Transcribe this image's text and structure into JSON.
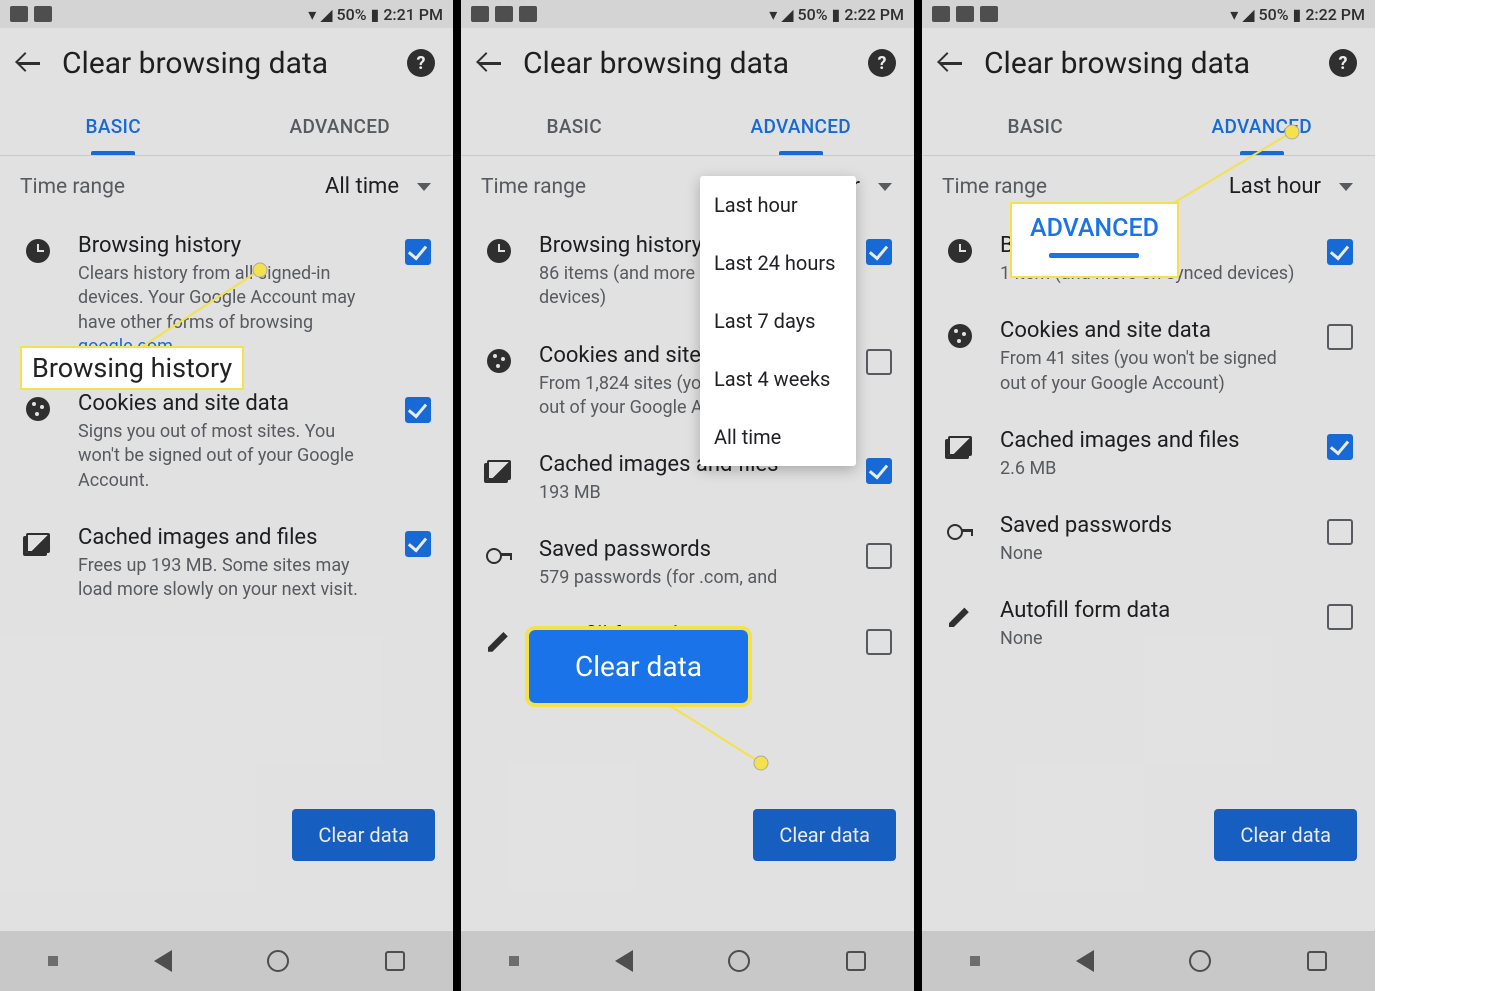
{
  "status": {
    "battery": "50%",
    "wifi_icon": "wifi-icon",
    "signal_icon": "signal-icon",
    "battery_icon": "battery-icon"
  },
  "screen1": {
    "time": "2:21 PM",
    "title": "Clear browsing data",
    "tabs": {
      "basic": "BASIC",
      "advanced": "ADVANCED",
      "active": "basic"
    },
    "time_range": {
      "label": "Time range",
      "value": "All time"
    },
    "items": [
      {
        "icon": "clock",
        "title": "Browsing history",
        "sub": "Clears history from all signed-in devices. Your Google Account may have other forms of browsing",
        "link": "google.com.",
        "checked": true
      },
      {
        "icon": "cookie",
        "title": "Cookies and site data",
        "sub": "Signs you out of most sites. You won't be signed out of your Google Account.",
        "checked": true
      },
      {
        "icon": "image",
        "title": "Cached images and files",
        "sub": "Frees up 193 MB. Some sites may load more slowly on your next visit.",
        "checked": true
      }
    ],
    "clear_btn": "Clear data",
    "callout": "Browsing history"
  },
  "screen2": {
    "time": "2:22 PM",
    "title": "Clear browsing data",
    "tabs": {
      "basic": "BASIC",
      "advanced": "ADVANCED",
      "active": "advanced"
    },
    "time_range": {
      "label": "Time range",
      "value": "Last hour"
    },
    "menu": [
      "Last hour",
      "Last 24 hours",
      "Last 7 days",
      "Last 4 weeks",
      "All time"
    ],
    "items": [
      {
        "icon": "clock",
        "title": "Browsing history",
        "sub": "86 items (and more on synced devices)",
        "checked": true
      },
      {
        "icon": "cookie",
        "title": "Cookies and site data",
        "sub": "From 1,824 sites (you won't be signed out of your Google Account)",
        "checked": false
      },
      {
        "icon": "image",
        "title": "Cached images and files",
        "sub": "193 MB",
        "checked": true
      },
      {
        "icon": "key",
        "title": "Saved passwords",
        "sub": "579 passwords (for                          .com, and",
        "checked": false
      },
      {
        "icon": "pen",
        "title": "Autofill form data",
        "sub": "",
        "checked": false
      }
    ],
    "clear_btn": "Clear data",
    "callout_btn": "Clear data"
  },
  "screen3": {
    "time": "2:22 PM",
    "title": "Clear browsing data",
    "tabs": {
      "basic": "BASIC",
      "advanced": "ADVANCED",
      "active": "advanced"
    },
    "time_range": {
      "label": "Time range",
      "value": "Last hour"
    },
    "items": [
      {
        "icon": "clock",
        "title": "Browsing history",
        "sub": "1 item (and more on synced devices)",
        "checked": true
      },
      {
        "icon": "cookie",
        "title": "Cookies and site data",
        "sub": "From 41 sites (you won't be signed out of your Google Account)",
        "checked": false
      },
      {
        "icon": "image",
        "title": "Cached images and files",
        "sub": "2.6 MB",
        "checked": true
      },
      {
        "icon": "key",
        "title": "Saved passwords",
        "sub": "None",
        "checked": false
      },
      {
        "icon": "pen",
        "title": "Autofill form data",
        "sub": "None",
        "checked": false
      }
    ],
    "clear_btn": "Clear data",
    "callout_tab": "ADVANCED"
  }
}
